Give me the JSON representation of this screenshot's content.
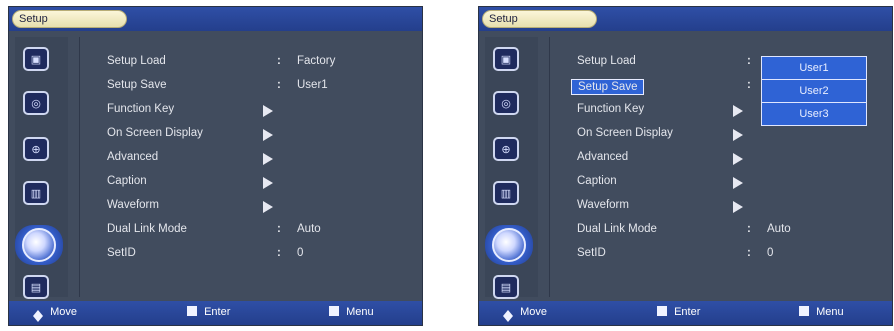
{
  "left": {
    "title": "Setup",
    "menu": [
      {
        "label": "Setup Load",
        "colon": ":",
        "value": "Factory"
      },
      {
        "label": "Setup Save",
        "colon": ":",
        "value": "User1"
      },
      {
        "label": "Function Key",
        "arrow": "▶"
      },
      {
        "label": "On Screen Display",
        "arrow": "▶"
      },
      {
        "label": "Advanced",
        "arrow": "▶"
      },
      {
        "label": "Caption",
        "arrow": "▶"
      },
      {
        "label": "Waveform",
        "arrow": "▶"
      },
      {
        "label": "Dual Link Mode",
        "colon": ":",
        "value": "Auto"
      },
      {
        "label": "SetID",
        "colon": ":",
        "value": "0"
      }
    ],
    "footer": {
      "move": "Move",
      "enter": "Enter",
      "menu": "Menu"
    }
  },
  "right": {
    "title": "Setup",
    "menu": [
      {
        "label": "Setup Load",
        "colon": ":",
        "value": ""
      },
      {
        "label": "Setup Save",
        "colon": ":",
        "value": "",
        "highlight": true
      },
      {
        "label": "Function Key",
        "arrow": "▶"
      },
      {
        "label": "On Screen Display",
        "arrow": "▶"
      },
      {
        "label": "Advanced",
        "arrow": "▶"
      },
      {
        "label": "Caption",
        "arrow": "▶"
      },
      {
        "label": "Waveform",
        "arrow": "▶"
      },
      {
        "label": "Dual Link Mode",
        "colon": ":",
        "value": "Auto"
      },
      {
        "label": "SetID",
        "colon": ":",
        "value": "0"
      }
    ],
    "dropdown": [
      "User1",
      "User2",
      "User3"
    ],
    "footer": {
      "move": "Move",
      "enter": "Enter",
      "menu": "Menu"
    }
  },
  "icons": [
    "input-icon",
    "speaker-icon",
    "picture-icon",
    "remote-icon",
    "setup-globe-icon",
    "tv-icon"
  ]
}
